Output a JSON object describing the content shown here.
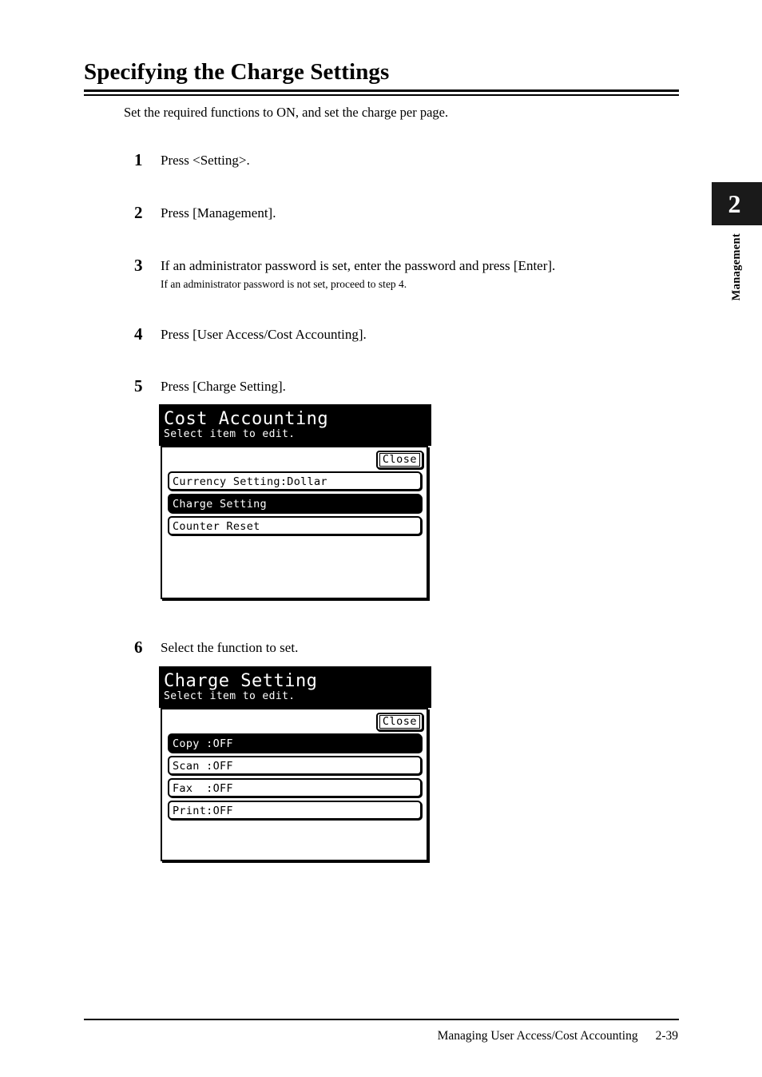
{
  "document": {
    "title": "Specifying the Charge Settings",
    "intro": "Set the required functions to ON, and set the charge per page.",
    "steps": [
      {
        "num": "1",
        "text": "Press <Setting>."
      },
      {
        "num": "2",
        "text": "Press [Management]."
      },
      {
        "num": "3",
        "text": "If an administrator password is set, enter the password and press [Enter].",
        "sub": "If an administrator password is not set, proceed to step 4."
      },
      {
        "num": "4",
        "text": "Press [User Access/Cost Accounting]."
      },
      {
        "num": "5",
        "text": "Press [Charge Setting]."
      },
      {
        "num": "6",
        "text": "Select the function to set."
      }
    ]
  },
  "screens": [
    {
      "title": "Cost Accounting",
      "subtitle": "Select item to edit.",
      "close_label": "Close",
      "items": [
        {
          "label": "Currency Setting:Dollar",
          "selected": false
        },
        {
          "label": "Charge Setting",
          "selected": true
        },
        {
          "label": "Counter Reset",
          "selected": false
        }
      ]
    },
    {
      "title": "Charge Setting",
      "subtitle": "Select item to edit.",
      "close_label": "Close",
      "items": [
        {
          "label": "Copy :OFF",
          "selected": true
        },
        {
          "label": "Scan :OFF",
          "selected": false
        },
        {
          "label": "Fax  :OFF",
          "selected": false
        },
        {
          "label": "Print:OFF",
          "selected": false
        }
      ]
    }
  ],
  "chapter_tab": {
    "number": "2",
    "label": "Management"
  },
  "footer": {
    "section": "Managing User Access/Cost Accounting",
    "page": "2-39"
  }
}
